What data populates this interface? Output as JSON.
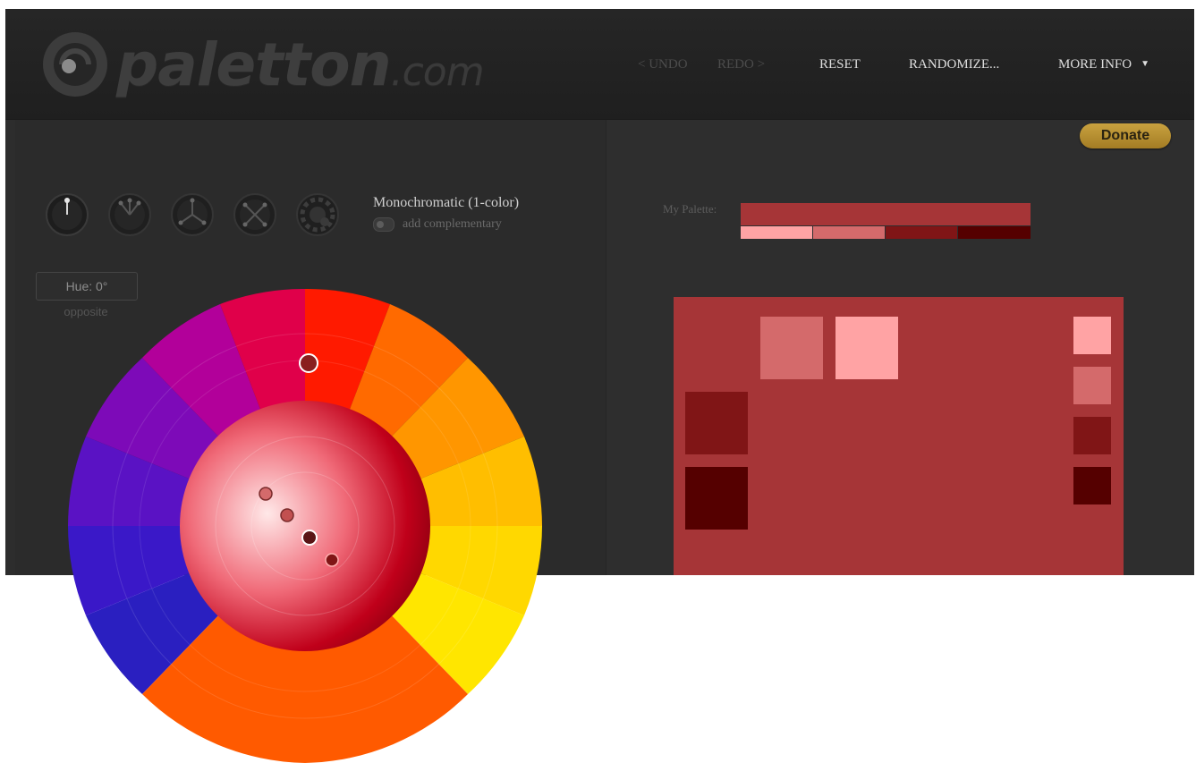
{
  "logo": {
    "name": "paletton",
    "tld": ".com"
  },
  "nav": {
    "undo": "< UNDO",
    "redo": "REDO >",
    "reset": "RESET",
    "randomize": "RANDOMIZE...",
    "more_info": "MORE INFO",
    "more_info_caret": "▼"
  },
  "donate_label": "Donate",
  "scheme": {
    "title": "Monochromatic (1-color)",
    "add_complementary": "add complementary",
    "modes": [
      "mono-icon",
      "adjacent-icon",
      "triad-icon",
      "tetrad-icon",
      "free-style-icon"
    ]
  },
  "hue": {
    "label": "Hue: 0°",
    "opposite": "opposite"
  },
  "palette": {
    "label": "My Palette:",
    "main": "#a63537",
    "shades": [
      "#ffa3a4",
      "#d46a6b",
      "#801516",
      "#550000"
    ]
  },
  "preview": {
    "background": "#a63537",
    "swatches": [
      "#d46a6b",
      "#ffa3a4",
      "#801516",
      "#550000"
    ]
  },
  "colors": {
    "frame": "#2d2d2d",
    "header": "#232323",
    "accent_gold": "#b8913a",
    "primary_red": "#a63537"
  }
}
